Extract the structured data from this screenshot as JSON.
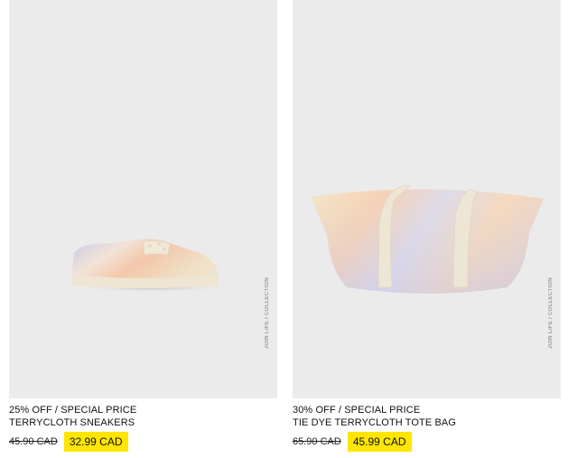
{
  "products": [
    {
      "promo": "25% OFF / SPECIAL PRICE",
      "name": "TERRYCLOTH SNEAKERS",
      "old_price": "45.90 CAD",
      "sale_price": "32.99 CAD",
      "watermark": "JOIN LIFE / COLLECTION"
    },
    {
      "promo": "30% OFF / SPECIAL PRICE",
      "name": "TIE DYE TERRYCLOTH TOTE BAG",
      "old_price": "65.90 CAD",
      "sale_price": "45.99 CAD",
      "watermark": "JOIN LIFE / COLLECTION"
    }
  ],
  "colors": {
    "image_bg": "#ebebeb",
    "sale_highlight": "#ffe500",
    "text": "#111111"
  }
}
